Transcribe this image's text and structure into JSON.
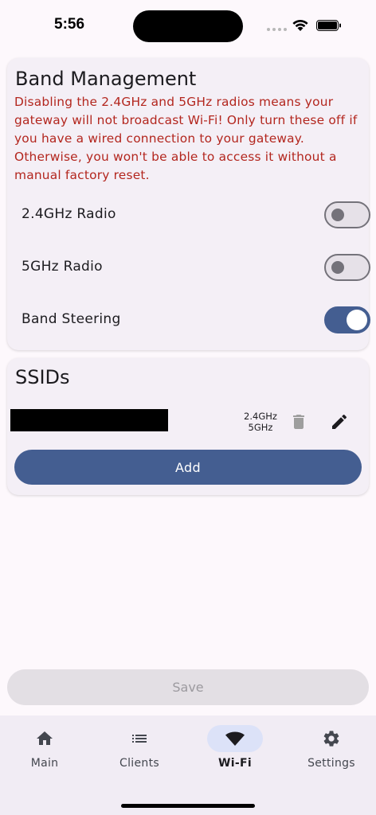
{
  "status_bar": {
    "time": "5:56"
  },
  "band_management": {
    "title": "Band Management",
    "warning": "Disabling the 2.4GHz and 5GHz radios means your gateway will not broadcast Wi-Fi! Only turn these off if you have a wired connection to your gateway. Otherwise, you won't be able to access it without a manual factory reset.",
    "toggles": [
      {
        "label": "2.4GHz Radio",
        "on": false
      },
      {
        "label": "5GHz Radio",
        "on": false
      },
      {
        "label": "Band Steering",
        "on": true
      }
    ]
  },
  "ssids": {
    "title": "SSIDs",
    "items": [
      {
        "name": "",
        "bands": [
          "2.4GHz",
          "5GHz"
        ]
      }
    ],
    "add_label": "Add"
  },
  "save_label": "Save",
  "nav": {
    "items": [
      {
        "label": "Main",
        "icon": "home-icon",
        "active": false
      },
      {
        "label": "Clients",
        "icon": "list-icon",
        "active": false
      },
      {
        "label": "Wi-Fi",
        "icon": "wifi-icon",
        "active": true
      },
      {
        "label": "Settings",
        "icon": "gear-icon",
        "active": false
      }
    ]
  },
  "colors": {
    "primary": "#445e91",
    "warning": "#b3261e",
    "card": "#f4eff6",
    "background": "#fdf8fc"
  }
}
